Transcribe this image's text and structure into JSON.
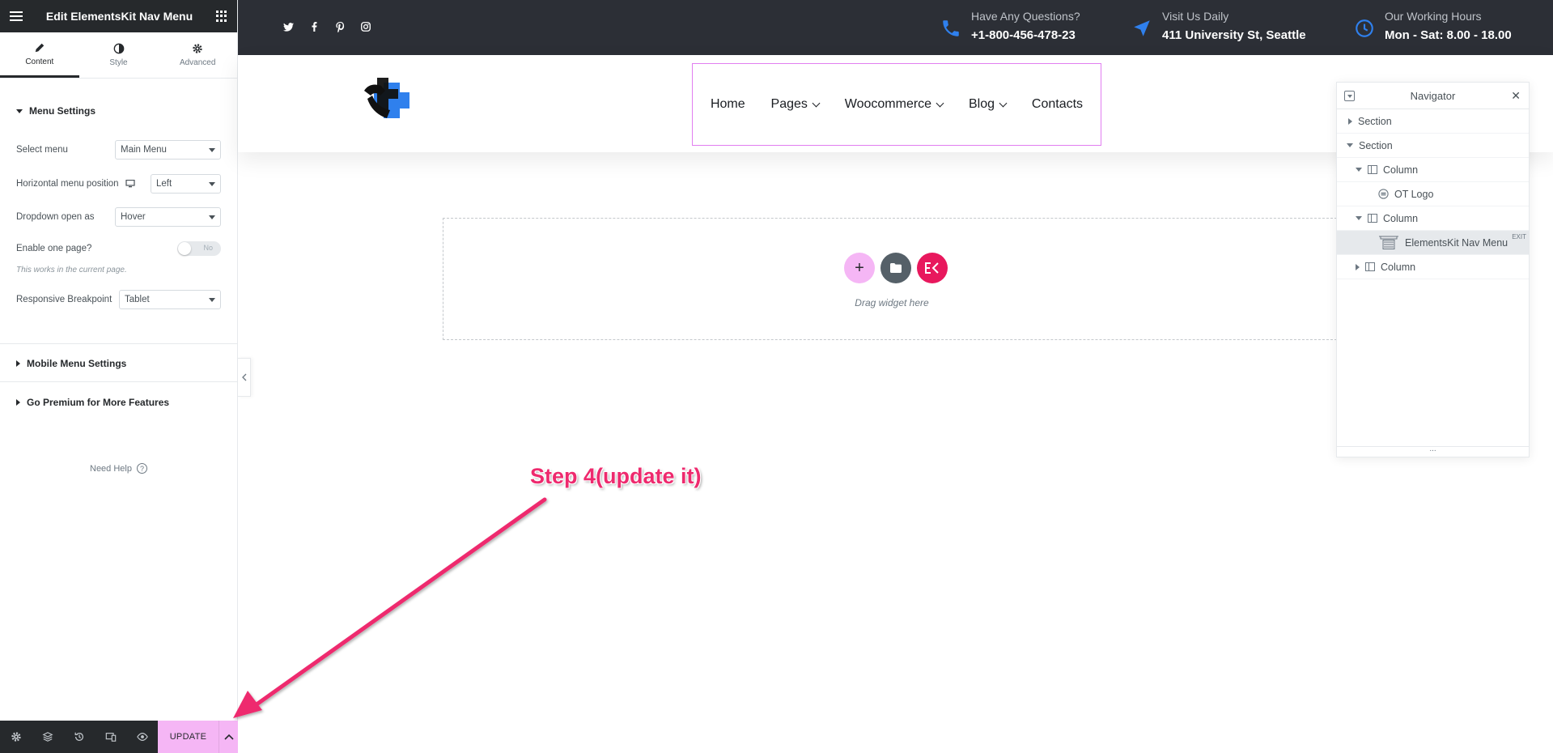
{
  "panel": {
    "title": "Edit ElementsKit Nav Menu",
    "tabs": [
      {
        "label": "Content",
        "icon": "pencil-icon",
        "active": true
      },
      {
        "label": "Style",
        "icon": "half-circle-icon"
      },
      {
        "label": "Advanced",
        "icon": "gear-icon"
      }
    ],
    "menu_settings": {
      "title": "Menu Settings",
      "select_menu": {
        "label": "Select menu",
        "value": "Main Menu"
      },
      "horizontal_position": {
        "label": "Horizontal menu position",
        "value": "Left"
      },
      "dropdown_open": {
        "label": "Dropdown open as",
        "value": "Hover"
      },
      "one_page": {
        "label": "Enable one page?",
        "value": "No",
        "note": "This works in the current page."
      },
      "breakpoint": {
        "label": "Responsive Breakpoint",
        "value": "Tablet"
      }
    },
    "mobile_menu_settings": "Mobile Menu Settings",
    "go_premium": "Go Premium for More Features",
    "need_help": "Need Help",
    "footer": {
      "update_label": "UPDATE",
      "update_color": "#f5b6f5"
    }
  },
  "topbar": {
    "questions": {
      "title": "Have Any Questions?",
      "value": "+1-800-456-478-23"
    },
    "visit": {
      "title": "Visit Us Daily",
      "value": "411 University St, Seattle"
    },
    "hours": {
      "title": "Our Working Hours",
      "value": "Mon - Sat: 8.00 - 18.00"
    },
    "accent": "#2f80ed"
  },
  "nav_menu": {
    "items": [
      {
        "label": "Home",
        "dropdown": false
      },
      {
        "label": "Pages",
        "dropdown": true
      },
      {
        "label": "Woocommerce",
        "dropdown": true
      },
      {
        "label": "Blog",
        "dropdown": true
      },
      {
        "label": "Contacts",
        "dropdown": false
      }
    ]
  },
  "dropzone": {
    "text": "Drag widget here"
  },
  "navigator": {
    "title": "Navigator",
    "rows": [
      {
        "label": "Section",
        "caret": "right"
      },
      {
        "label": "Section",
        "caret": "down"
      },
      {
        "label": "Column",
        "caret": "down"
      },
      {
        "label": "OT Logo"
      },
      {
        "label": "Column",
        "caret": "down"
      },
      {
        "label": "ElementsKit Nav Menu",
        "badge": "EXIT",
        "selected": true
      },
      {
        "label": "Column",
        "caret": "right"
      }
    ],
    "footer_handle": "..."
  },
  "annotation": {
    "label": "Step 4(update it)",
    "color": "#ee2a6e"
  }
}
